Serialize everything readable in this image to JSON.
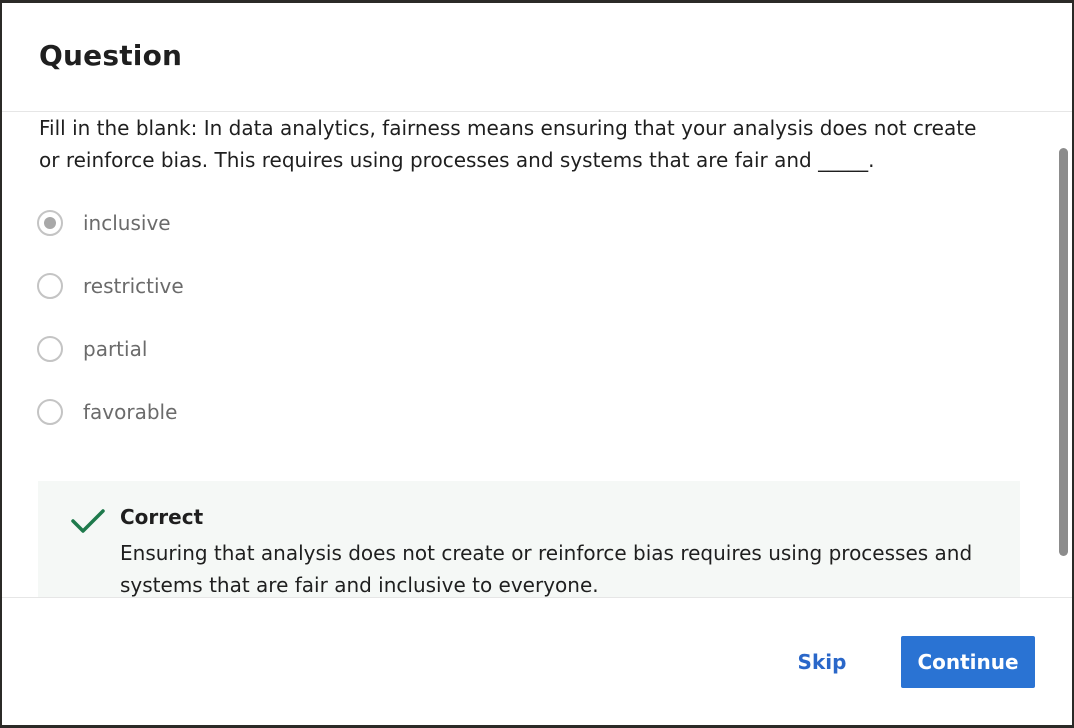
{
  "dialog": {
    "title": "Question"
  },
  "question": {
    "text": "Fill in the blank: In data analytics, fairness means ensuring that your analysis does not create or reinforce bias. This requires using processes and systems that are fair and _____."
  },
  "options": [
    {
      "label": "inclusive",
      "selected": true
    },
    {
      "label": "restrictive",
      "selected": false
    },
    {
      "label": "partial",
      "selected": false
    },
    {
      "label": "favorable",
      "selected": false
    }
  ],
  "feedback": {
    "title": "Correct",
    "text": "Ensuring that analysis does not create or reinforce bias requires using processes and systems that are fair and inclusive to everyone.",
    "icon": "check-icon",
    "color": "#1e7a4c"
  },
  "footer": {
    "skip_label": "Skip",
    "continue_label": "Continue"
  },
  "colors": {
    "accent": "#2a73d3",
    "link": "#2a67c9",
    "success": "#1e7a4c",
    "feedback_bg": "#f5f8f6"
  }
}
